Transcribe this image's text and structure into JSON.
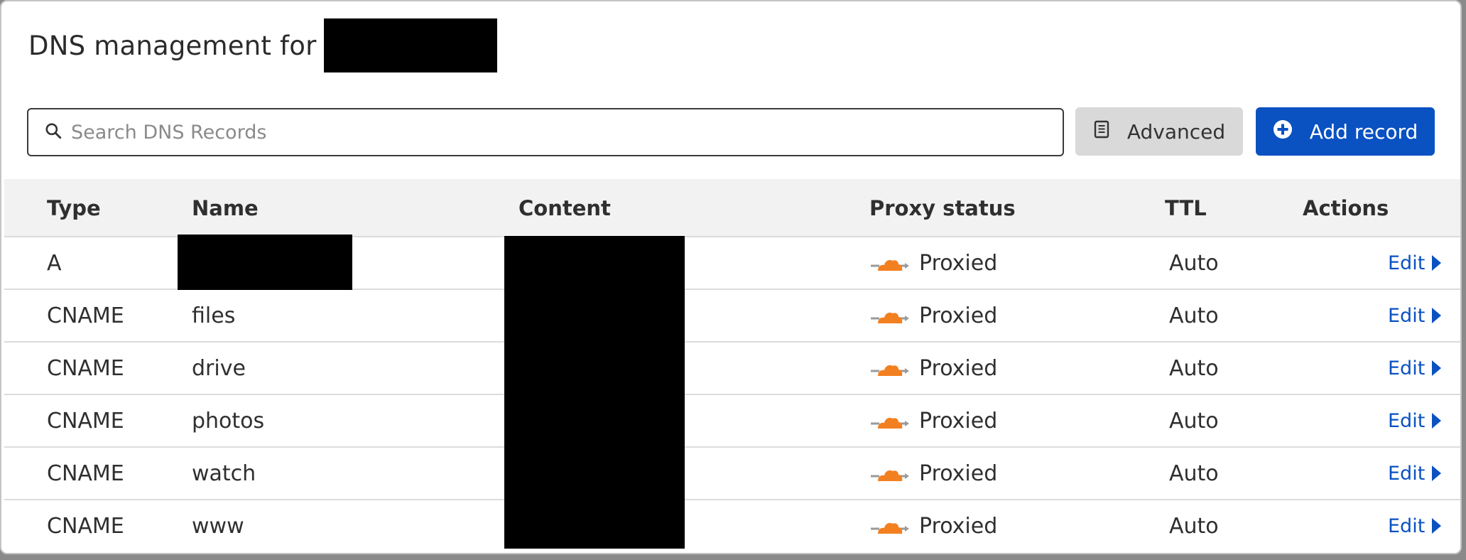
{
  "header": {
    "title": "DNS management for"
  },
  "search": {
    "placeholder": "Search DNS Records",
    "value": ""
  },
  "toolbar": {
    "advanced_label": "Advanced",
    "add_record_label": "Add record"
  },
  "table": {
    "columns": [
      "Type",
      "Name",
      "Content",
      "Proxy status",
      "TTL",
      "Actions"
    ],
    "rows": [
      {
        "type": "A",
        "name": "",
        "content": "",
        "proxy_status": "Proxied",
        "ttl": "Auto",
        "action": "Edit"
      },
      {
        "type": "CNAME",
        "name": "files",
        "content": "",
        "proxy_status": "Proxied",
        "ttl": "Auto",
        "action": "Edit"
      },
      {
        "type": "CNAME",
        "name": "drive",
        "content": "",
        "proxy_status": "Proxied",
        "ttl": "Auto",
        "action": "Edit"
      },
      {
        "type": "CNAME",
        "name": "photos",
        "content": "",
        "proxy_status": "Proxied",
        "ttl": "Auto",
        "action": "Edit"
      },
      {
        "type": "CNAME",
        "name": "watch",
        "content": "",
        "proxy_status": "Proxied",
        "ttl": "Auto",
        "action": "Edit"
      },
      {
        "type": "CNAME",
        "name": "www",
        "content": "",
        "proxy_status": "Proxied",
        "ttl": "Auto",
        "action": "Edit"
      }
    ]
  },
  "icons": {
    "search": "search-icon",
    "advanced": "document-icon",
    "add": "plus-circle-icon",
    "proxied": "orange-cloud-icon",
    "edit": "caret-right-icon"
  },
  "colors": {
    "accent": "#0a51c2",
    "cloud": "#f38020",
    "advanced_bg": "#d9d9d9",
    "header_bg": "#f2f2f2"
  }
}
